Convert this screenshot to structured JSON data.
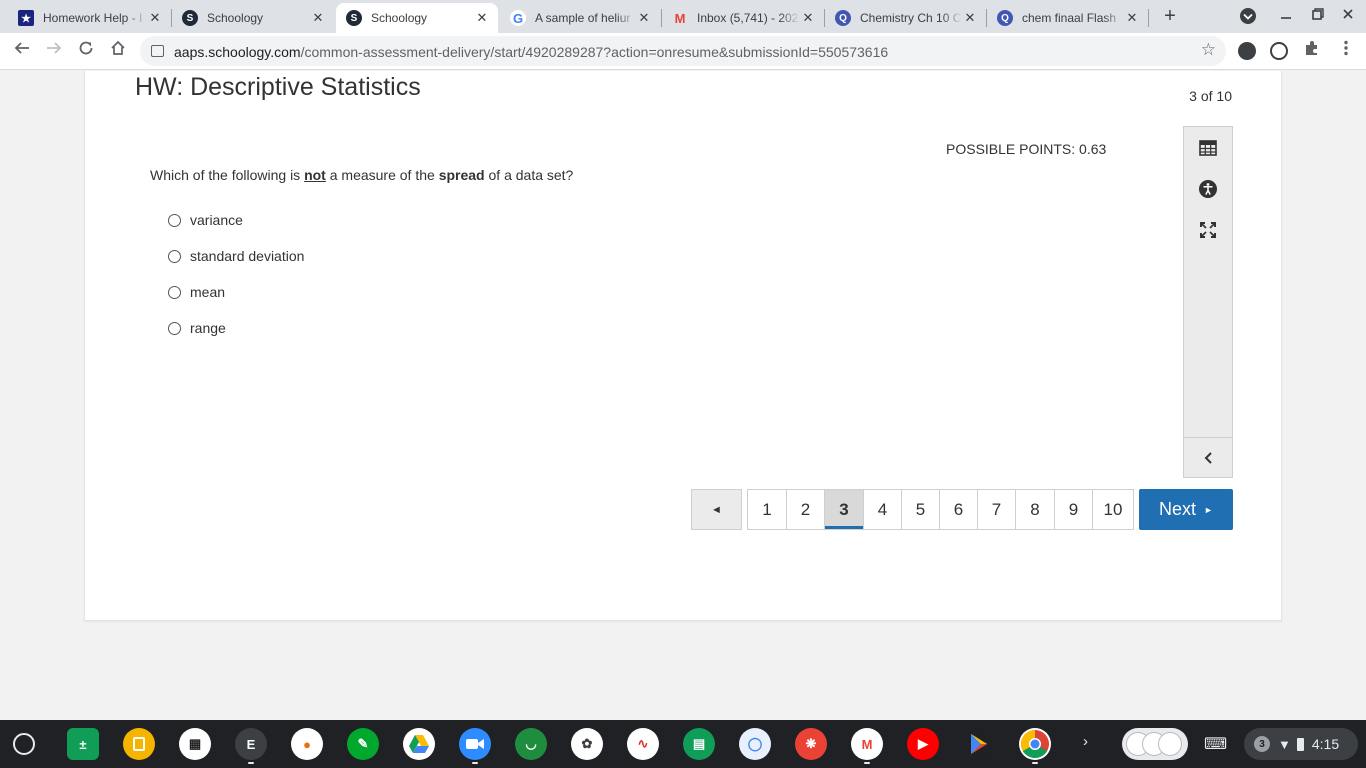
{
  "tabs": [
    {
      "title": "Homework Help - I",
      "icon": "star-favicon"
    },
    {
      "title": "Schoology",
      "icon": "schoology-favicon"
    },
    {
      "title": "Schoology",
      "icon": "schoology-favicon",
      "active": true
    },
    {
      "title": "A sample of heliur",
      "icon": "google-favicon"
    },
    {
      "title": "Inbox (5,741) - 202",
      "icon": "gmail-favicon"
    },
    {
      "title": "Chemistry Ch 10 C",
      "icon": "quizlet-favicon"
    },
    {
      "title": "chem finaal Flash",
      "icon": "quizlet-favicon"
    }
  ],
  "toolbar": {
    "url_host": "aaps.schoology.com",
    "url_path": "/common-assessment-delivery/start/4920289287?action=onresume&submissionId=550573616"
  },
  "assessment": {
    "title": "HW: Descriptive Statistics",
    "progress": "3 of 10",
    "points": "POSSIBLE POINTS: 0.63",
    "question": {
      "pre": "Which of the following is ",
      "emph_not": "not",
      "mid": " a measure of the ",
      "emph_spread": "spread",
      "post": " of a data set?"
    },
    "choices": [
      "variance",
      "standard deviation",
      "mean",
      "range"
    ]
  },
  "pager": {
    "pages": [
      "1",
      "2",
      "3",
      "4",
      "5",
      "6",
      "7",
      "8",
      "9",
      "10"
    ],
    "current": "3",
    "prev_symbol": "◄",
    "next_label": "Next",
    "next_symbol": "►"
  },
  "shelf": {
    "notification_count": "3",
    "time": "4:15",
    "editor_app_letter": "E"
  },
  "colors": {
    "primary_blue": "#1f6fb2",
    "tab_bg": "#dee1e6",
    "shelf_bg": "#202124"
  }
}
